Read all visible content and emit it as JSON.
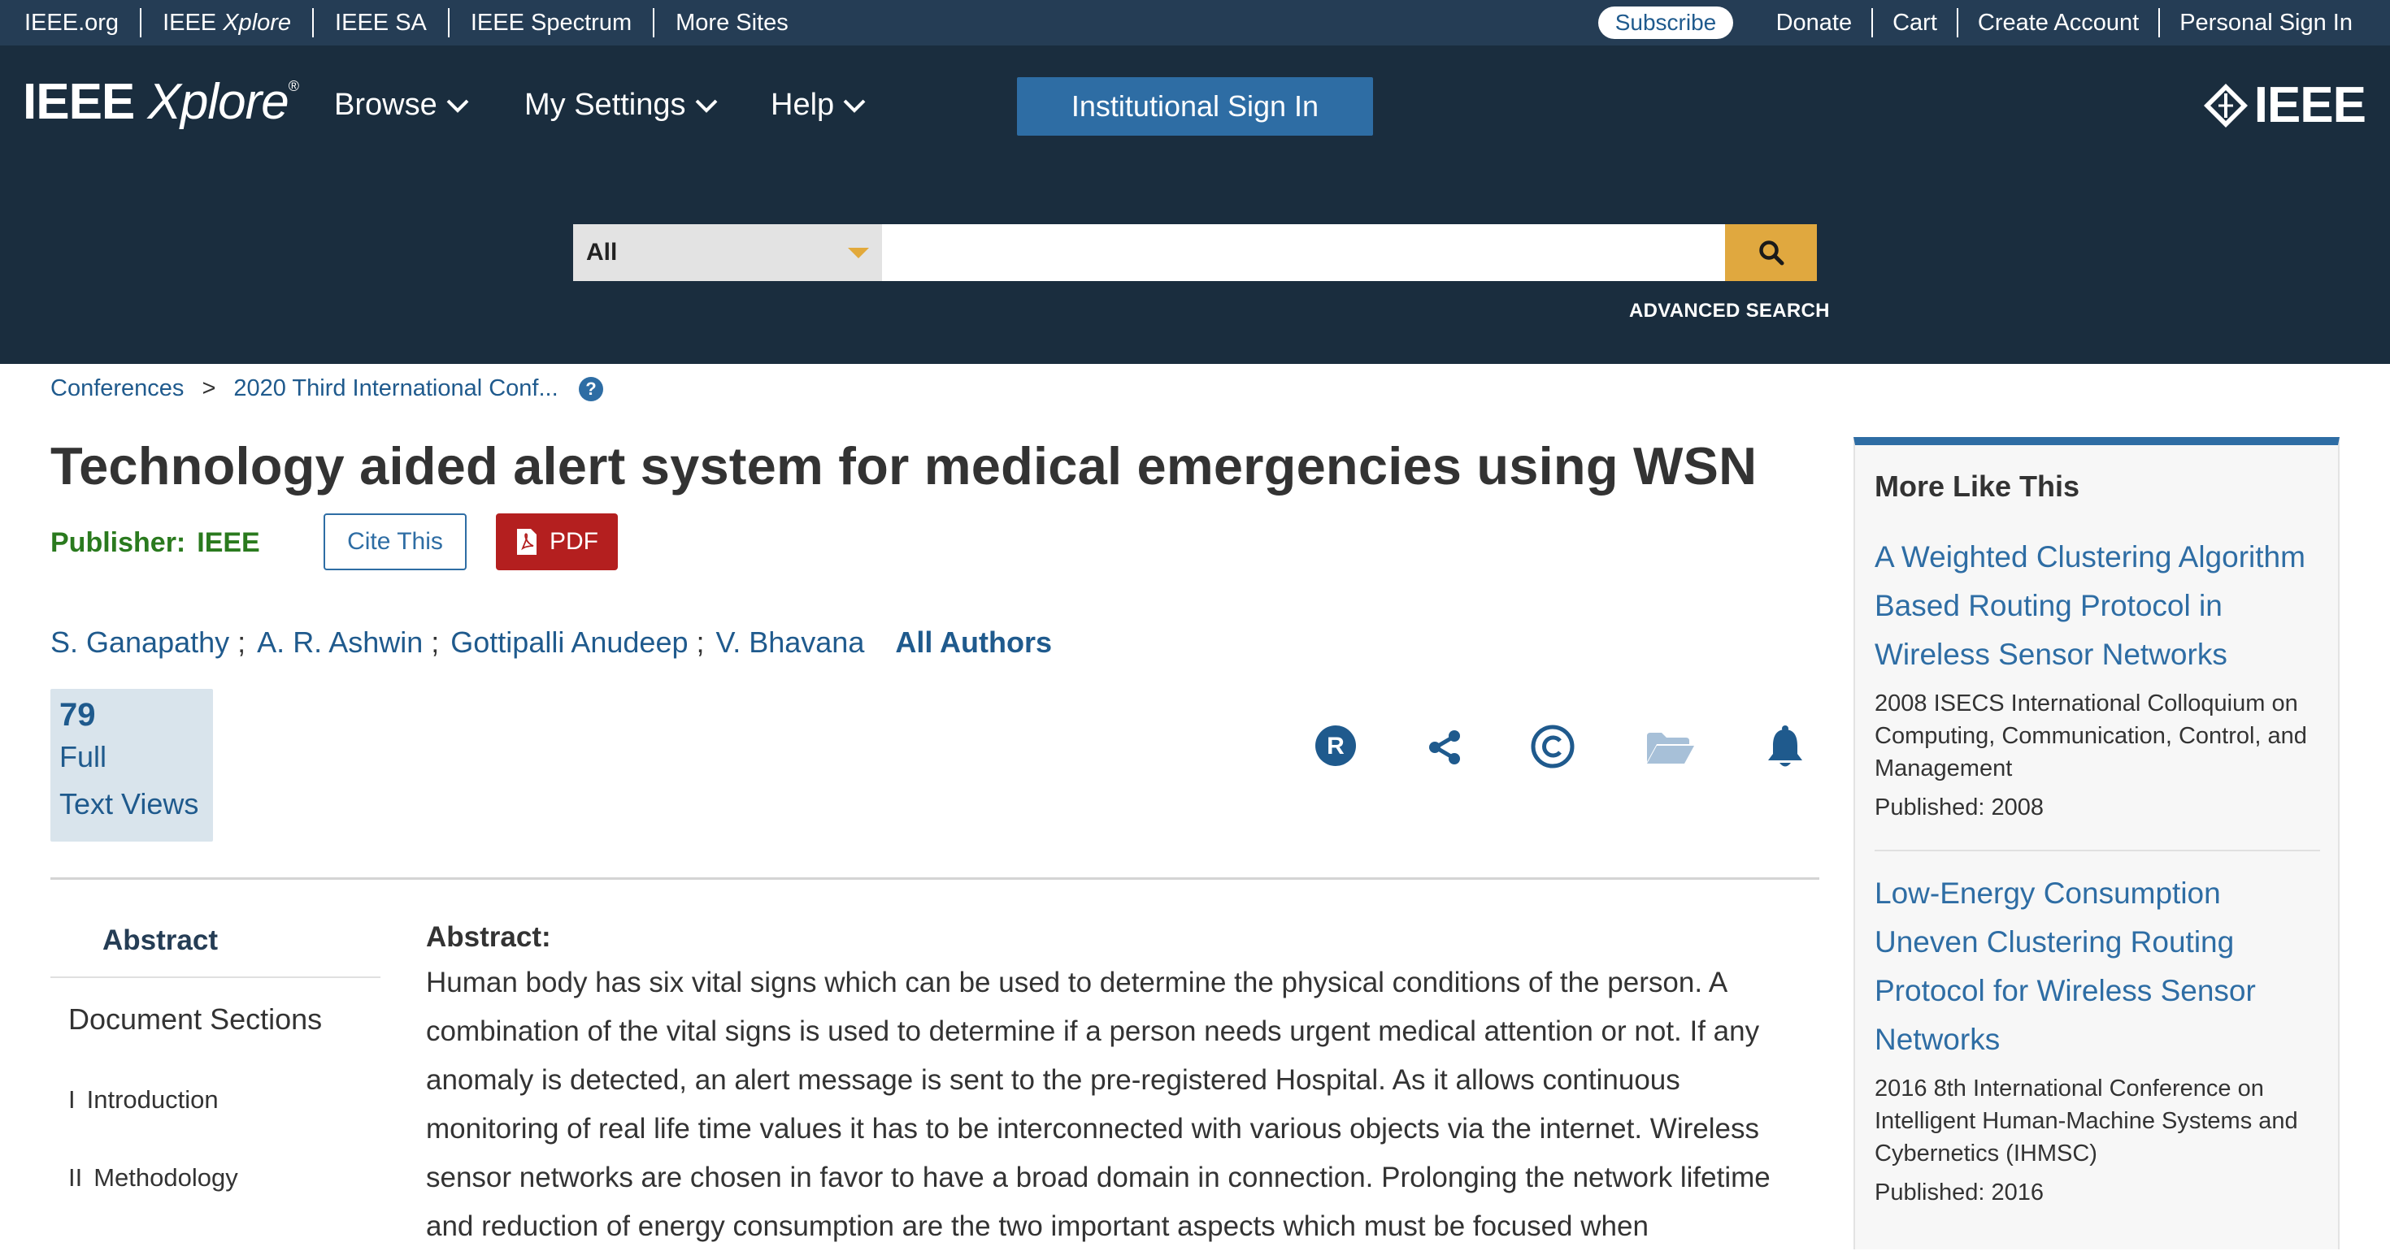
{
  "utility_bar": {
    "left_links": [
      "IEEE.org",
      "IEEE ",
      "IEEE SA",
      "IEEE Spectrum",
      "More Sites"
    ],
    "xplore_italic": "Xplore",
    "subscribe": "Subscribe",
    "right_links": [
      "Donate",
      "Cart",
      "Create Account",
      "Personal Sign In"
    ]
  },
  "header": {
    "logo_ieee": "IEEE",
    "logo_xplore": "Xplore",
    "logo_reg": "®",
    "nav": [
      "Browse",
      "My Settings",
      "Help"
    ],
    "institutional_sign_in": "Institutional Sign In",
    "brand": "IEEE"
  },
  "search": {
    "scope_value": "All",
    "query_value": "",
    "advanced_label": "ADVANCED SEARCH"
  },
  "breadcrumb": [
    "Conferences",
    ">",
    "2020 Third International Conf..."
  ],
  "article": {
    "title": "Technology aided alert system for medical emergencies using WSN",
    "publisher_label": "Publisher:",
    "publisher_value": "IEEE",
    "cite_label": "Cite This",
    "pdf_label": "PDF",
    "authors": [
      "S. Ganapathy",
      "A. R. Ashwin",
      "Gottipalli Anudeep",
      "V. Bhavana"
    ],
    "author_separator": ";",
    "all_authors_label": "All Authors",
    "metrics": {
      "value": "79",
      "label_line1": "Full",
      "label_line2": "Text Views"
    }
  },
  "action_icons": [
    "rights-icon",
    "share-icon",
    "copyright-icon",
    "folder-icon",
    "bell-icon"
  ],
  "doc_nav": {
    "active": "Abstract",
    "heading": "Document Sections",
    "items": [
      {
        "num": "I",
        "label": "Introduction"
      },
      {
        "num": "II",
        "label": "Methodology"
      }
    ]
  },
  "abstract": {
    "heading": "Abstract:",
    "text": "Human body has six vital signs which can be used to determine the physical conditions of the person. A combination of the vital signs is used to determine if a person needs urgent medical attention or not. If any anomaly is detected, an alert message is sent to the pre-registered Hospital. As it allows continuous monitoring of real life time values it has to be interconnected with various objects via the internet. Wireless sensor networks are chosen in favor to have a broad domain in connection. Prolonging the network lifetime and reduction of energy consumption are the two important aspects which must be focused when"
  },
  "sidebar": {
    "title": "More Like This",
    "items": [
      {
        "title": "A Weighted Clustering Algorithm Based Routing Protocol in Wireless Sensor Networks",
        "venue": "2008 ISECS International Colloquium on Computing, Communication, Control, and Management",
        "published": "Published: 2008"
      },
      {
        "title": "Low-Energy Consumption Uneven Clustering Routing Protocol for Wireless Sensor Networks",
        "venue": "2016 8th International Conference on Intelligent Human-Machine Systems and Cybernetics (IHMSC)",
        "published": "Published: 2016"
      }
    ]
  },
  "colors": {
    "utility_bar": "#253d55",
    "header": "#1a2d3e",
    "accent_blue": "#2e6da4",
    "link_blue": "#1f5a8d",
    "search_button": "#e0a83f",
    "publisher_green": "#2a7a1e",
    "pdf_red": "#b41f1f"
  }
}
